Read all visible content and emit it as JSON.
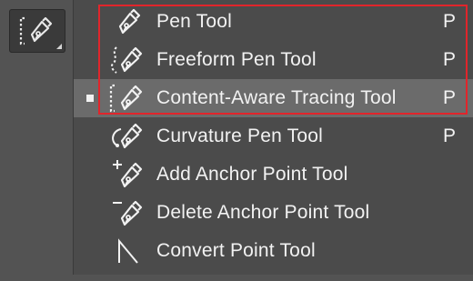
{
  "toolbar": {
    "active_tool_icon": "content-aware-tracing-icon"
  },
  "menu": {
    "items": [
      {
        "label": "Pen Tool",
        "shortcut": "P",
        "icon": "pen-icon"
      },
      {
        "label": "Freeform Pen Tool",
        "shortcut": "P",
        "icon": "freeform-pen-icon"
      },
      {
        "label": "Content-Aware Tracing Tool",
        "shortcut": "P",
        "icon": "content-aware-tracing-icon",
        "selected": true
      },
      {
        "label": "Curvature Pen Tool",
        "shortcut": "P",
        "icon": "curvature-pen-icon"
      },
      {
        "label": "Add Anchor Point Tool",
        "shortcut": "",
        "icon": "add-anchor-point-icon"
      },
      {
        "label": "Delete Anchor Point Tool",
        "shortcut": "",
        "icon": "delete-anchor-point-icon"
      },
      {
        "label": "Convert Point Tool",
        "shortcut": "",
        "icon": "convert-point-icon"
      }
    ]
  },
  "colors": {
    "highlight_border": "#e1252b",
    "active_row": "#6b6b6b",
    "menu_bg": "#4b4b4b",
    "panel_bg": "#535353",
    "text": "#f2f2f2"
  }
}
